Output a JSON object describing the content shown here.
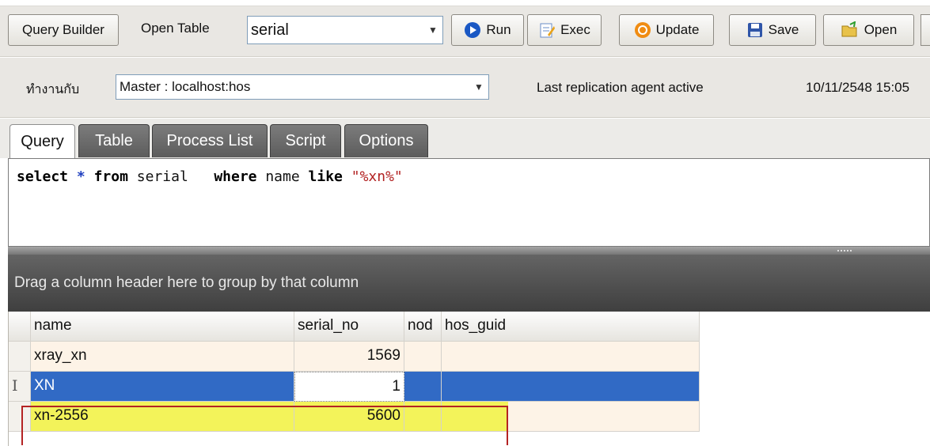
{
  "toolbar": {
    "query_builder_label": "Query Builder",
    "open_table_label": "Open Table",
    "open_table_value": "serial",
    "run_label": "Run",
    "exec_label": "Exec",
    "update_label": "Update",
    "save_label": "Save",
    "open_label": "Open"
  },
  "connection": {
    "work_with_label": "ทำงานกับ",
    "server_value": "Master : localhost:hos",
    "status_text": "Last replication agent active",
    "timestamp": "10/11/2548 15:05"
  },
  "tabs": [
    {
      "label": "Query",
      "active": true
    },
    {
      "label": "Table",
      "active": false
    },
    {
      "label": "Process List",
      "active": false
    },
    {
      "label": "Script",
      "active": false
    },
    {
      "label": "Options",
      "active": false
    }
  ],
  "editor": {
    "tokens": [
      "select",
      "*",
      "from",
      "serial",
      "where",
      "name",
      "like",
      "\"%xn%\""
    ]
  },
  "grid": {
    "group_hint": "Drag a column header here to group by that column",
    "columns": [
      "name",
      "serial_no",
      "node",
      "hos_guid"
    ],
    "columns_display": [
      "name",
      "serial_no",
      "nod",
      "hos_guid"
    ],
    "rows": [
      {
        "name": "xray_xn",
        "serial_no": "1569",
        "node": "",
        "hos_guid": ""
      },
      {
        "name": "XN",
        "serial_no": "1",
        "node": "",
        "hos_guid": ""
      },
      {
        "name": "xn-2556",
        "serial_no": "5600",
        "node": "",
        "hos_guid": ""
      }
    ],
    "row_indicator": "I"
  },
  "colors": {
    "selected_row": "#316ac5",
    "highlight": "#f3f35a",
    "annotation_box": "#b42323",
    "row_bg": "#fdf3e7"
  }
}
